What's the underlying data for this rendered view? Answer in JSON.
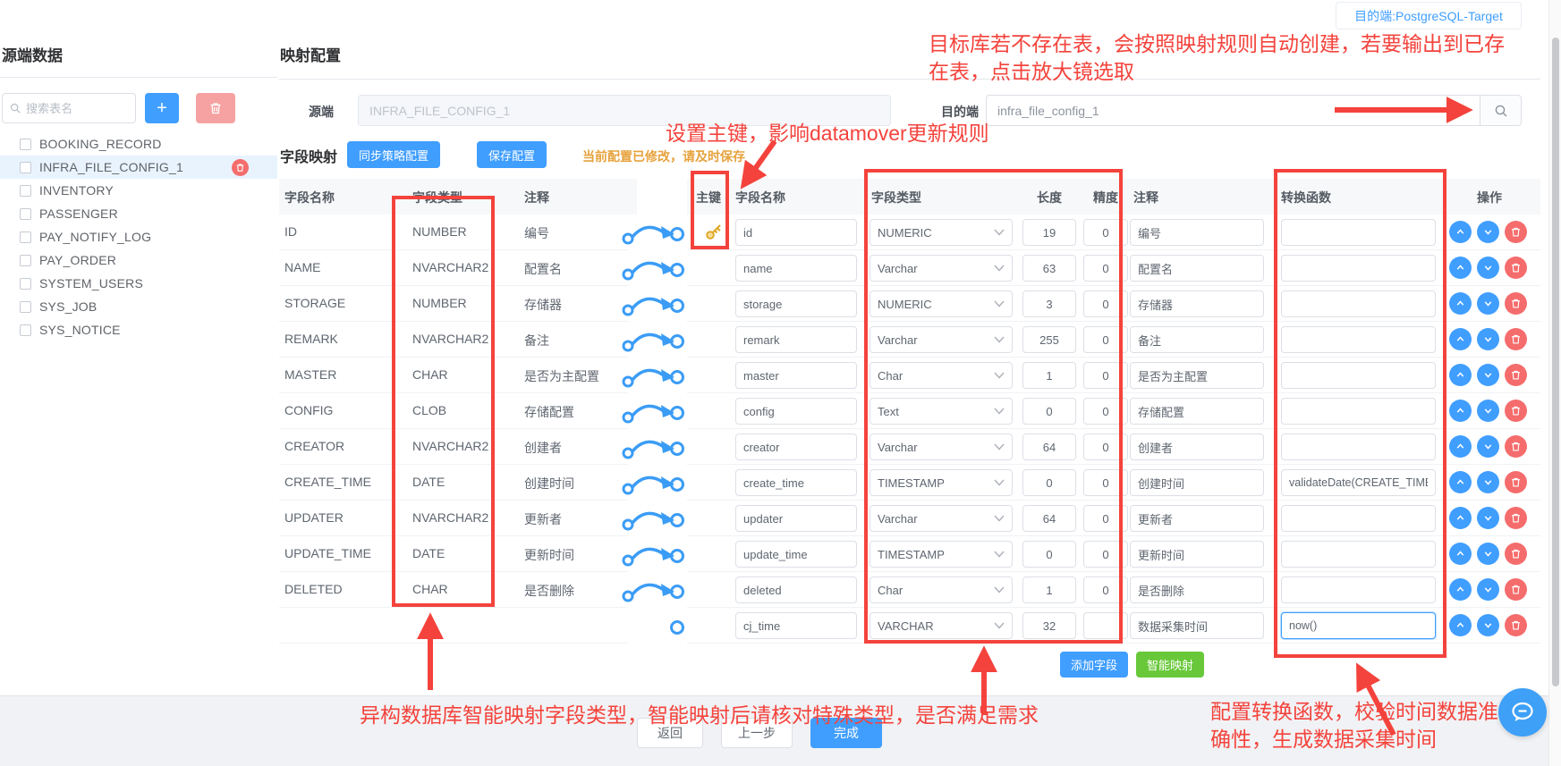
{
  "badge": {
    "text": "目的端:PostgreSQL-Target"
  },
  "sidebar": {
    "title": "源端数据",
    "search_placeholder": "搜索表名",
    "add_icon": "+",
    "tables": [
      {
        "name": "BOOKING_RECORD",
        "selected": false
      },
      {
        "name": "INFRA_FILE_CONFIG_1",
        "selected": true
      },
      {
        "name": "INVENTORY",
        "selected": false
      },
      {
        "name": "PASSENGER",
        "selected": false
      },
      {
        "name": "PAY_NOTIFY_LOG",
        "selected": false
      },
      {
        "name": "PAY_ORDER",
        "selected": false
      },
      {
        "name": "SYSTEM_USERS",
        "selected": false
      },
      {
        "name": "SYS_JOB",
        "selected": false
      },
      {
        "name": "SYS_NOTICE",
        "selected": false
      }
    ]
  },
  "main": {
    "title": "映射配置",
    "source_label": "源端",
    "source_value": "INFRA_FILE_CONFIG_1",
    "target_label": "目的端",
    "target_value": "infra_file_config_1",
    "section_title": "字段映射",
    "sync_button": "同步策略配置",
    "save_button": "保存配置",
    "warning": "当前配置已修改，请及时保存",
    "add_field_button": "添加字段",
    "smart_map_button": "智能映射",
    "footer": {
      "back": "返回",
      "prev": "上一步",
      "finish": "完成"
    }
  },
  "table": {
    "headers": {
      "src_name": "字段名称",
      "src_type": "字段类型",
      "src_comment": "注释",
      "pk": "主键",
      "name": "字段名称",
      "type": "字段类型",
      "len": "长度",
      "prec": "精度",
      "comment": "注释",
      "func": "转换函数",
      "actions": "操作"
    },
    "rows": [
      {
        "src_name": "ID",
        "src_type": "NUMBER",
        "src_comment": "编号",
        "linked": true,
        "pk": true,
        "name": "id",
        "type": "NUMERIC",
        "len": "19",
        "prec": "0",
        "comment": "编号",
        "func": "",
        "func_focused": false
      },
      {
        "src_name": "NAME",
        "src_type": "NVARCHAR2",
        "src_comment": "配置名",
        "linked": true,
        "pk": false,
        "name": "name",
        "type": "Varchar",
        "len": "63",
        "prec": "0",
        "comment": "配置名",
        "func": "",
        "func_focused": false
      },
      {
        "src_name": "STORAGE",
        "src_type": "NUMBER",
        "src_comment": "存储器",
        "linked": true,
        "pk": false,
        "name": "storage",
        "type": "NUMERIC",
        "len": "3",
        "prec": "0",
        "comment": "存储器",
        "func": "",
        "func_focused": false
      },
      {
        "src_name": "REMARK",
        "src_type": "NVARCHAR2",
        "src_comment": "备注",
        "linked": true,
        "pk": false,
        "name": "remark",
        "type": "Varchar",
        "len": "255",
        "prec": "0",
        "comment": "备注",
        "func": "",
        "func_focused": false
      },
      {
        "src_name": "MASTER",
        "src_type": "CHAR",
        "src_comment": "是否为主配置",
        "linked": true,
        "pk": false,
        "name": "master",
        "type": "Char",
        "len": "1",
        "prec": "0",
        "comment": "是否为主配置",
        "func": "",
        "func_focused": false
      },
      {
        "src_name": "CONFIG",
        "src_type": "CLOB",
        "src_comment": "存储配置",
        "linked": true,
        "pk": false,
        "name": "config",
        "type": "Text",
        "len": "0",
        "prec": "0",
        "comment": "存储配置",
        "func": "",
        "func_focused": false
      },
      {
        "src_name": "CREATOR",
        "src_type": "NVARCHAR2",
        "src_comment": "创建者",
        "linked": true,
        "pk": false,
        "name": "creator",
        "type": "Varchar",
        "len": "64",
        "prec": "0",
        "comment": "创建者",
        "func": "",
        "func_focused": false
      },
      {
        "src_name": "CREATE_TIME",
        "src_type": "DATE",
        "src_comment": "创建时间",
        "linked": true,
        "pk": false,
        "name": "create_time",
        "type": "TIMESTAMP",
        "len": "0",
        "prec": "0",
        "comment": "创建时间",
        "func": "validateDate(CREATE_TIME)",
        "func_focused": false
      },
      {
        "src_name": "UPDATER",
        "src_type": "NVARCHAR2",
        "src_comment": "更新者",
        "linked": true,
        "pk": false,
        "name": "updater",
        "type": "Varchar",
        "len": "64",
        "prec": "0",
        "comment": "更新者",
        "func": "",
        "func_focused": false
      },
      {
        "src_name": "UPDATE_TIME",
        "src_type": "DATE",
        "src_comment": "更新时间",
        "linked": true,
        "pk": false,
        "name": "update_time",
        "type": "TIMESTAMP",
        "len": "0",
        "prec": "0",
        "comment": "更新时间",
        "func": "",
        "func_focused": false
      },
      {
        "src_name": "DELETED",
        "src_type": "CHAR",
        "src_comment": "是否删除",
        "linked": true,
        "pk": false,
        "name": "deleted",
        "type": "Char",
        "len": "1",
        "prec": "0",
        "comment": "是否删除",
        "func": "",
        "func_focused": false
      },
      {
        "src_name": "",
        "src_type": "",
        "src_comment": "",
        "linked": false,
        "pk": false,
        "name": "cj_time",
        "type": "VARCHAR",
        "len": "32",
        "prec": "",
        "comment": "数据采集时间",
        "func": "now()",
        "func_focused": true
      }
    ]
  },
  "annotations": {
    "target_note": "目标库若不存在表，会按照映射规则自动创建，若要输出到已存在表，点击放大镜选取",
    "pk_note": "设置主键，影响datamover更新规则",
    "type_note": "异构数据库智能映射字段类型，智能映射后请核对特殊类型，是否满足需求",
    "func_note": "配置转换函数，校验时间数据准确性，生成数据采集时间"
  },
  "colors": {
    "accent": "#409eff",
    "green": "#67c23a",
    "danger": "#f56c6c",
    "warn": "#e6a23c",
    "annotation": "#f4433c"
  }
}
